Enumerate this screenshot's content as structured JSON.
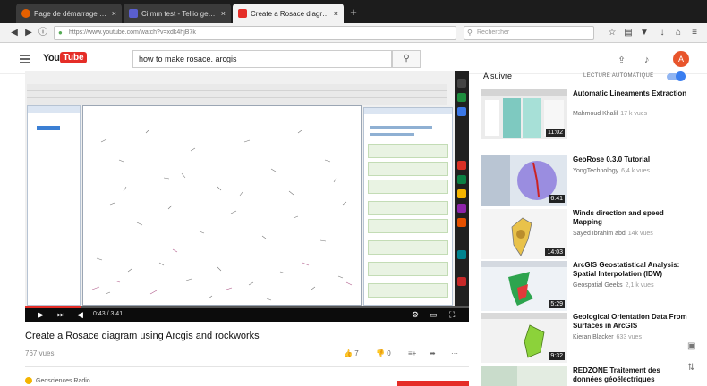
{
  "browser": {
    "tabs": [
      {
        "label": "Page de démarrage de Mo...",
        "icon": "firefox-icon",
        "color": "#e66000",
        "active": false
      },
      {
        "label": "Ci mm test - Tellio geo - Ya...",
        "icon": "mail-icon",
        "color": "#5a5fcf",
        "active": false
      },
      {
        "label": "Create a Rosace diagram u...",
        "icon": "youtube-icon",
        "color": "#e52d27",
        "active": true
      }
    ],
    "new_tab": "+",
    "url": "https://www.youtube.com/watch?v=xdk4hjB7k",
    "search_placeholder": "Rechercher"
  },
  "youtube": {
    "logo_you": "You",
    "logo_tube": "Tube",
    "search_query": "how to make rosace. arcgis",
    "avatar_letter": "A"
  },
  "video": {
    "title": "Create a Rosace diagram using Arcgis and rockworks",
    "views": "767 vues",
    "time": "0:43 / 3:41",
    "progress": 0.125,
    "likes": "7",
    "dislikes": "0",
    "channel": "Geosciences Radio"
  },
  "sidebar": {
    "up_next": "A suivre",
    "autoplay": "LECTURE AUTOMATIQUE",
    "autoplay_on": true,
    "items": [
      {
        "title": "Automatic Lineaments Extraction",
        "channel": "Mahmoud Khalil",
        "views": "17 k vues",
        "duration": "11:02"
      },
      {
        "title": "GeoRose 0.3.0 Tutorial",
        "channel": "YongTechnology",
        "views": "6,4 k vues",
        "duration": "6:41"
      },
      {
        "title": "Winds direction and speed Mapping",
        "channel": "Sayed Ibrahim abd",
        "views": "14k vues",
        "duration": "14:03"
      },
      {
        "title": "ArcGIS Geostatistical Analysis: Spatial Interpolation (IDW)",
        "channel": "Geospatial Geeks",
        "views": "2,1 k vues",
        "duration": "5:29"
      },
      {
        "title": "Geological Orientation Data From Surfaces in ArcGIS",
        "channel": "Kieran Blacker",
        "views": "633 vues",
        "duration": "9:32"
      },
      {
        "title": "REDZONE Traitement des données géoélectriques",
        "channel": "",
        "views": "",
        "duration": ""
      }
    ]
  },
  "colors": {
    "accent": "#e52d27",
    "toggle": "#3a7ef0"
  }
}
